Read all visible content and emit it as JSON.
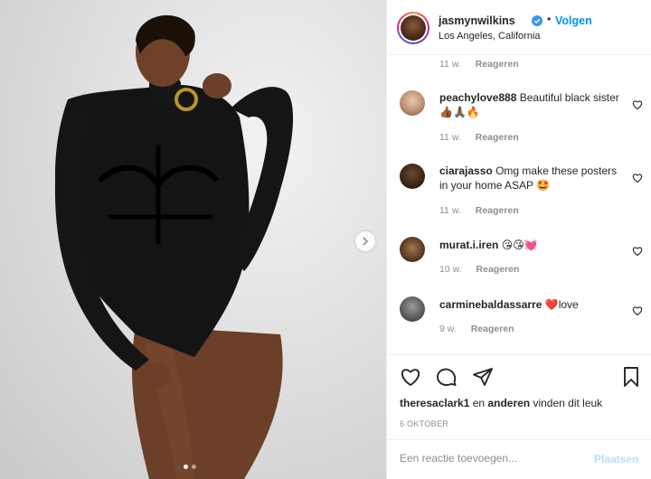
{
  "header": {
    "username": "jasmynwilkins",
    "separator": "•",
    "follow_label": "Volgen",
    "location": "Los Angeles, California"
  },
  "comments": [
    {
      "username": "",
      "text": "",
      "age": "11 w.",
      "reply_label": "Reageren"
    },
    {
      "username": "peachylove888",
      "text": "Beautiful black sister 👍🏾🙏🏾🔥",
      "age": "11 w.",
      "reply_label": "Reageren"
    },
    {
      "username": "ciarajasso",
      "text": "Omg make these posters in your home ASAP 🤩",
      "age": "11 w.",
      "reply_label": "Reageren"
    },
    {
      "username": "murat.i.iren",
      "text": "😘😘💓",
      "age": "10 w.",
      "reply_label": "Reageren"
    },
    {
      "username": "carminebaldassarre",
      "text": "❤️love",
      "age": "9 w.",
      "reply_label": "Reageren"
    }
  ],
  "likes": {
    "first_user": "theresaclark1",
    "and_text": "en",
    "others_label": "anderen",
    "suffix": "vinden dit leuk"
  },
  "post_date": "6 OKTOBER",
  "add_comment": {
    "placeholder": "Een reactie toevoegen...",
    "post_label": "Plaatsen"
  },
  "colors": {
    "accent_blue": "#0095f6",
    "post_disabled": "#b2dffc",
    "muted": "#8e8e8e"
  },
  "carousel": {
    "total_slides": 2,
    "active_slide": 1
  }
}
